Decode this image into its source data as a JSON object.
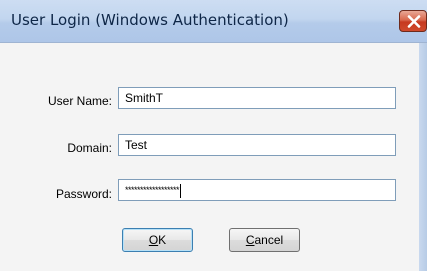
{
  "window": {
    "title": "User Login (Windows Authentication)"
  },
  "form": {
    "username": {
      "label": "User Name:",
      "value": "SmithT"
    },
    "domain": {
      "label": "Domain:",
      "value": "Test"
    },
    "password": {
      "label": "Password:",
      "masked_value": "******************"
    }
  },
  "buttons": {
    "ok": {
      "mnemonic": "O",
      "rest": "K"
    },
    "cancel": {
      "mnemonic": "C",
      "rest": "ancel"
    }
  },
  "colors": {
    "titlebar": "#c2d6ef",
    "close_button": "#c6391f",
    "client_background": "#f4f4f4",
    "textbox_border": "#7f9db9",
    "default_button_border": "#3c7fb1"
  },
  "icons": {
    "close": "close-x-icon"
  }
}
